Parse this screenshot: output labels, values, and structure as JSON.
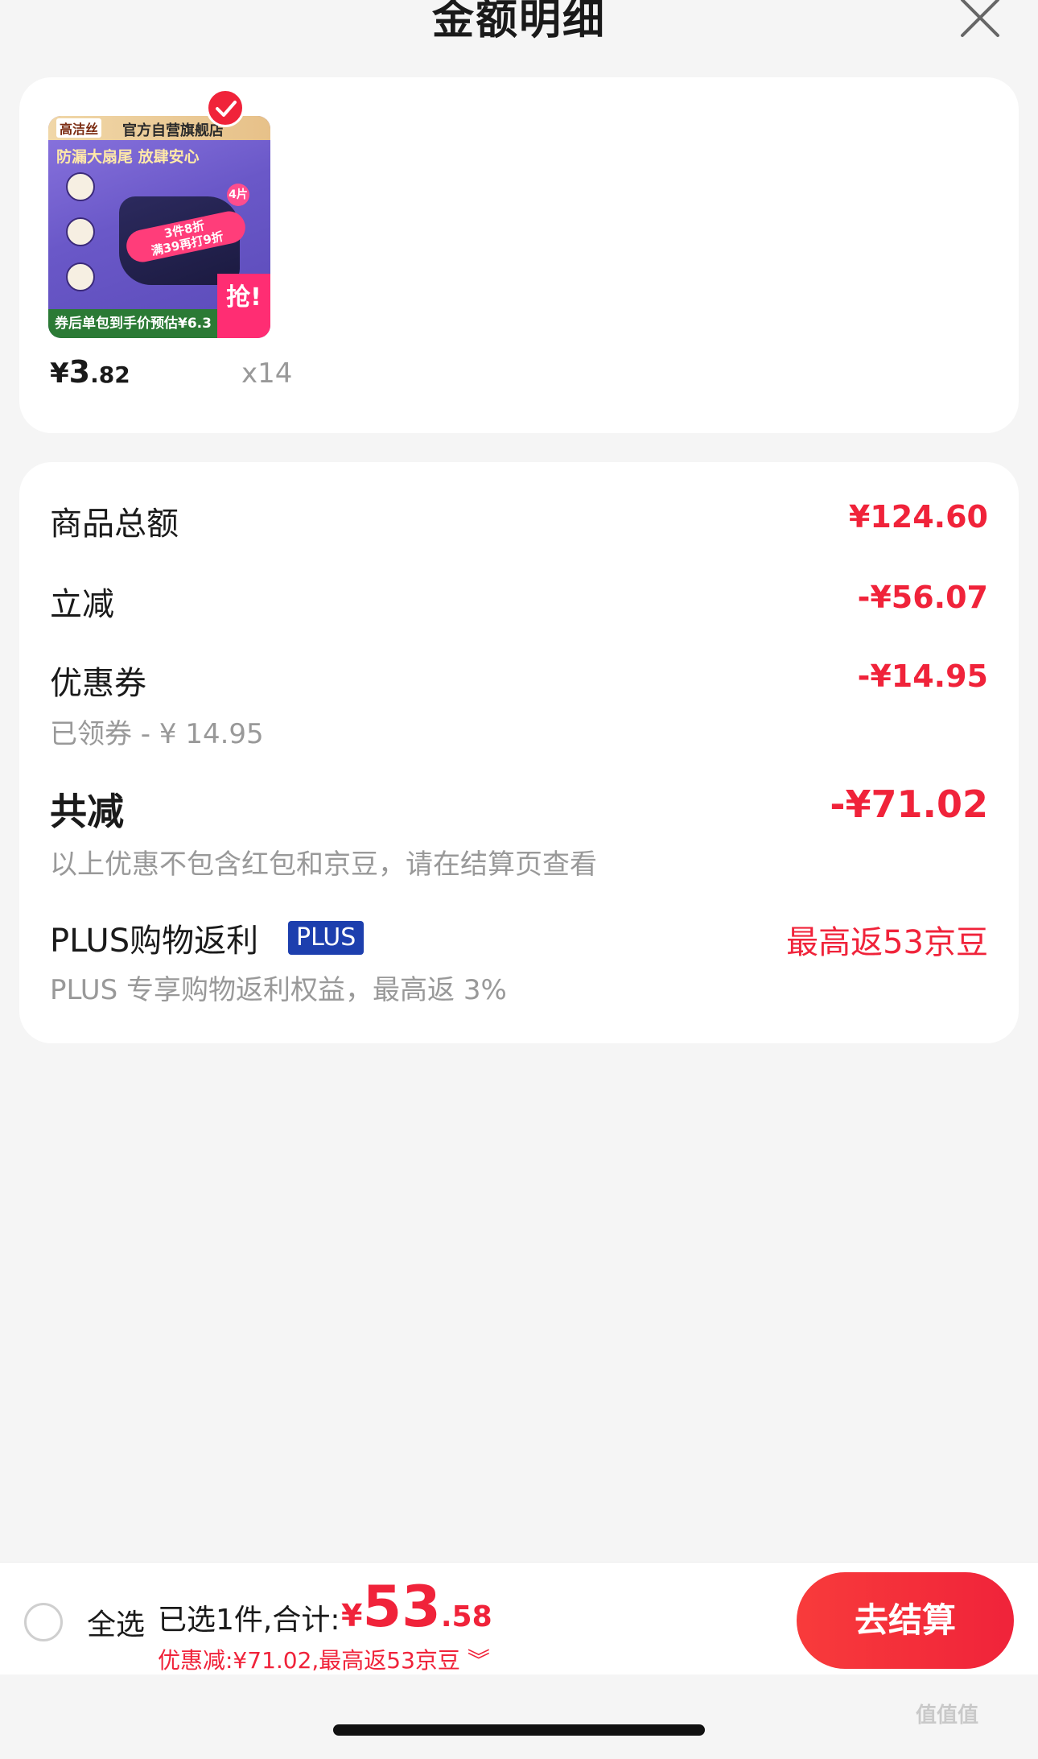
{
  "header": {
    "title": "金额明细"
  },
  "product": {
    "thumb_brand": "高洁丝",
    "thumb_shop": "官方自营旗舰店",
    "thumb_slogan": "防漏大扇尾 放肆安心",
    "thumb_tag_line1": "3件8折",
    "thumb_tag_line2": "满39再打9折",
    "thumb_count": "4片",
    "thumb_grab": "抢!",
    "thumb_bottom": "券后单包到手价预估¥6.3",
    "price_currency": "¥",
    "price_int": "3",
    "price_dec": ".82",
    "quantity": "x14",
    "selected": true
  },
  "details": {
    "subtotal_label": "商品总额",
    "subtotal_value": "¥124.60",
    "instant_label": "立减",
    "instant_value": "-¥56.07",
    "coupon_label": "优惠券",
    "coupon_sub": "已领券 - ¥ 14.95",
    "coupon_value": "-¥14.95",
    "total_off_label": "共减",
    "total_off_value": "-¥71.02",
    "total_off_note": "以上优惠不包含红包和京豆，请在结算页查看",
    "plus_label": "PLUS购物返利",
    "plus_badge": "PLUS",
    "plus_value": "最高返53京豆",
    "plus_sub": "PLUS 专享购物返利权益，最高返 3%"
  },
  "bottom_bar": {
    "select_all": "全选",
    "selected_summary": "已选1件,合计:",
    "total_currency": "¥",
    "total_int": "53",
    "total_dec": ".58",
    "discount_line": "优惠减:¥71.02,最高返53京豆 ︾",
    "checkout": "去结算"
  },
  "watermark": "值值值",
  "colors": {
    "accent": "#f0233a",
    "plus_badge": "#1d3fae",
    "background": "#f5f5f5"
  }
}
